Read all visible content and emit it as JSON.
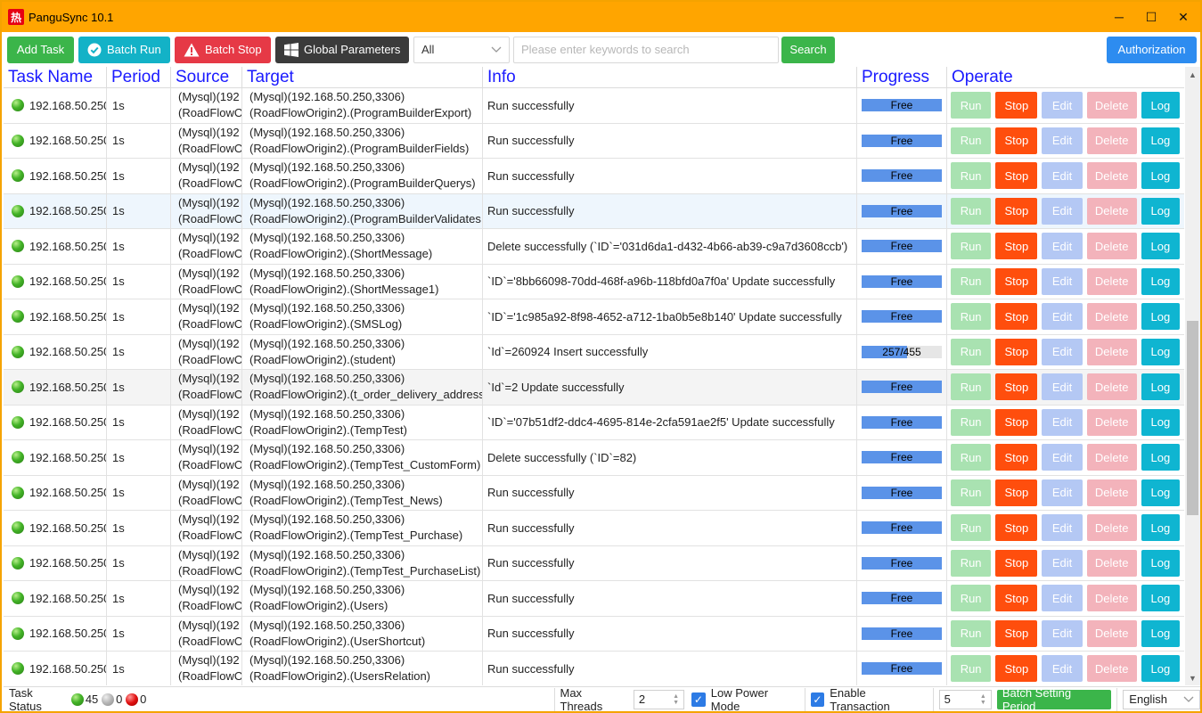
{
  "window": {
    "title": "PanguSync 10.1",
    "app_icon_glyph": "热",
    "controls": {
      "minimize": "─",
      "maximize": "☐",
      "close": "✕"
    }
  },
  "toolbar": {
    "add_task": "Add Task",
    "batch_run": "Batch Run",
    "batch_stop": "Batch Stop",
    "global_parameters": "Global Parameters",
    "filter_value": "All",
    "search_placeholder": "Please enter keywords to search",
    "search": "Search",
    "authorization": "Authorization"
  },
  "table": {
    "headers": {
      "name": "Task Name",
      "period": "Period",
      "source": "Source",
      "target": "Target",
      "info": "Info",
      "progress": "Progress",
      "operate": "Operate"
    },
    "row_labels": {
      "run": "Run",
      "stop": "Stop",
      "edit": "Edit",
      "delete": "Delete",
      "log": "Log"
    },
    "rows": [
      {
        "name": "192.168.50.250",
        "period": "1s",
        "src1": "(Mysql)(192",
        "src2": "(RoadFlowO",
        "tgt1": "(Mysql)(192.168.50.250,3306)",
        "tgt2": "(RoadFlowOrigin2).(ProgramBuilderExport)",
        "info": "Run successfully",
        "progress": "Free"
      },
      {
        "name": "192.168.50.250",
        "period": "1s",
        "src1": "(Mysql)(192",
        "src2": "(RoadFlowO",
        "tgt1": "(Mysql)(192.168.50.250,3306)",
        "tgt2": "(RoadFlowOrigin2).(ProgramBuilderFields)",
        "info": "Run successfully",
        "progress": "Free"
      },
      {
        "name": "192.168.50.250",
        "period": "1s",
        "src1": "(Mysql)(192",
        "src2": "(RoadFlowO",
        "tgt1": "(Mysql)(192.168.50.250,3306)",
        "tgt2": "(RoadFlowOrigin2).(ProgramBuilderQuerys)",
        "info": "Run successfully",
        "progress": "Free"
      },
      {
        "name": "192.168.50.250",
        "period": "1s",
        "src1": "(Mysql)(192",
        "src2": "(RoadFlowO",
        "tgt1": "(Mysql)(192.168.50.250,3306)",
        "tgt2": "(RoadFlowOrigin2).(ProgramBuilderValidates",
        "info": "Run successfully",
        "progress": "Free"
      },
      {
        "name": "192.168.50.250",
        "period": "1s",
        "src1": "(Mysql)(192",
        "src2": "(RoadFlowO",
        "tgt1": "(Mysql)(192.168.50.250,3306)",
        "tgt2": "(RoadFlowOrigin2).(ShortMessage)",
        "info": "Delete successfully (`ID`='031d6da1-d432-4b66-ab39-c9a7d3608ccb')",
        "progress": "Free"
      },
      {
        "name": "192.168.50.250",
        "period": "1s",
        "src1": "(Mysql)(192",
        "src2": "(RoadFlowO",
        "tgt1": "(Mysql)(192.168.50.250,3306)",
        "tgt2": "(RoadFlowOrigin2).(ShortMessage1)",
        "info": "`ID`='8bb66098-70dd-468f-a96b-118bfd0a7f0a' Update successfully",
        "progress": "Free"
      },
      {
        "name": "192.168.50.250",
        "period": "1s",
        "src1": "(Mysql)(192",
        "src2": "(RoadFlowO",
        "tgt1": "(Mysql)(192.168.50.250,3306)",
        "tgt2": "(RoadFlowOrigin2).(SMSLog)",
        "info": "`ID`='1c985a92-8f98-4652-a712-1ba0b5e8b140' Update successfully",
        "progress": "Free"
      },
      {
        "name": "192.168.50.250",
        "period": "1s",
        "src1": "(Mysql)(192",
        "src2": "(RoadFlowO",
        "tgt1": "(Mysql)(192.168.50.250,3306)",
        "tgt2": "(RoadFlowOrigin2).(student)",
        "info": "`Id`=260924 Insert successfully",
        "progress": "257/455",
        "progress_fraction": 0.565
      },
      {
        "name": "192.168.50.250",
        "period": "1s",
        "src1": "(Mysql)(192",
        "src2": "(RoadFlowO",
        "tgt1": "(Mysql)(192.168.50.250,3306)",
        "tgt2": "(RoadFlowOrigin2).(t_order_delivery_address",
        "info": "`Id`=2 Update successfully",
        "progress": "Free"
      },
      {
        "name": "192.168.50.250",
        "period": "1s",
        "src1": "(Mysql)(192",
        "src2": "(RoadFlowO",
        "tgt1": "(Mysql)(192.168.50.250,3306)",
        "tgt2": "(RoadFlowOrigin2).(TempTest)",
        "info": "`ID`='07b51df2-ddc4-4695-814e-2cfa591ae2f5' Update successfully",
        "progress": "Free"
      },
      {
        "name": "192.168.50.250",
        "period": "1s",
        "src1": "(Mysql)(192",
        "src2": "(RoadFlowO",
        "tgt1": "(Mysql)(192.168.50.250,3306)",
        "tgt2": "(RoadFlowOrigin2).(TempTest_CustomForm)",
        "info": "Delete successfully (`ID`=82)",
        "progress": "Free"
      },
      {
        "name": "192.168.50.250",
        "period": "1s",
        "src1": "(Mysql)(192",
        "src2": "(RoadFlowO",
        "tgt1": "(Mysql)(192.168.50.250,3306)",
        "tgt2": "(RoadFlowOrigin2).(TempTest_News)",
        "info": "Run successfully",
        "progress": "Free"
      },
      {
        "name": "192.168.50.250",
        "period": "1s",
        "src1": "(Mysql)(192",
        "src2": "(RoadFlowO",
        "tgt1": "(Mysql)(192.168.50.250,3306)",
        "tgt2": "(RoadFlowOrigin2).(TempTest_Purchase)",
        "info": "Run successfully",
        "progress": "Free"
      },
      {
        "name": "192.168.50.250",
        "period": "1s",
        "src1": "(Mysql)(192",
        "src2": "(RoadFlowO",
        "tgt1": "(Mysql)(192.168.50.250,3306)",
        "tgt2": "(RoadFlowOrigin2).(TempTest_PurchaseList)",
        "info": "Run successfully",
        "progress": "Free"
      },
      {
        "name": "192.168.50.250",
        "period": "1s",
        "src1": "(Mysql)(192",
        "src2": "(RoadFlowO",
        "tgt1": "(Mysql)(192.168.50.250,3306)",
        "tgt2": "(RoadFlowOrigin2).(Users)",
        "info": "Run successfully",
        "progress": "Free"
      },
      {
        "name": "192.168.50.250",
        "period": "1s",
        "src1": "(Mysql)(192",
        "src2": "(RoadFlowO",
        "tgt1": "(Mysql)(192.168.50.250,3306)",
        "tgt2": "(RoadFlowOrigin2).(UserShortcut)",
        "info": "Run successfully",
        "progress": "Free"
      },
      {
        "name": "192.168.50.250",
        "period": "1s",
        "src1": "(Mysql)(192",
        "src2": "(RoadFlowO",
        "tgt1": "(Mysql)(192.168.50.250,3306)",
        "tgt2": "(RoadFlowOrigin2).(UsersRelation)",
        "info": "Run successfully",
        "progress": "Free"
      }
    ]
  },
  "status": {
    "task_status_label": "Task Status",
    "green_count": "45",
    "gray_count": "0",
    "red_count": "0",
    "max_threads_label": "Max Threads",
    "max_threads_value": "2",
    "low_power_label": "Low Power Mode",
    "enable_transaction_label": "Enable Transaction",
    "period_value": "5",
    "batch_setting_period": "Batch Setting Period",
    "language": "English"
  },
  "colors": {
    "title_bar": "#ffa500",
    "header_text": "#1a1aff",
    "progress_fill": "#5b93e8",
    "run": "#a9e2b1",
    "stop": "#ff4e0d",
    "edit": "#b4c8f4",
    "delete": "#f3b3bb",
    "log": "#0fb5d1"
  },
  "icons": {
    "batch_run": "check-circle-icon",
    "batch_stop": "warning-triangle-icon",
    "global_parameters": "windows-icon",
    "filter_dropdown": "chevron-down-icon"
  }
}
